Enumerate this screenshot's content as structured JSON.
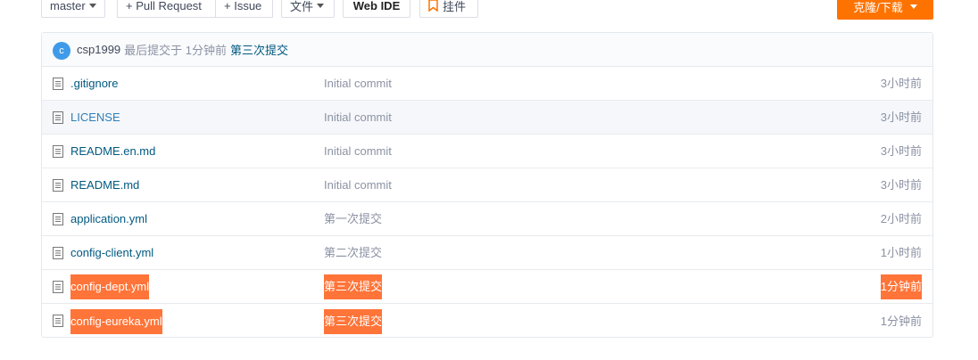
{
  "toolbar": {
    "branch": "master",
    "pull_request": "+ Pull Request",
    "issue": "+ Issue",
    "file_menu": "文件",
    "web_ide": "Web IDE",
    "plugin": "挂件",
    "clone": "克隆/下载"
  },
  "last_commit": {
    "avatar_letter": "c",
    "author": "csp1999",
    "meta_text": "最后提交于 1分钟前",
    "message": "第三次提交"
  },
  "files": [
    {
      "name": ".gitignore",
      "message": "Initial commit",
      "time": "3小时前"
    },
    {
      "name": "LICENSE",
      "message": "Initial commit",
      "time": "3小时前"
    },
    {
      "name": "README.en.md",
      "message": "Initial commit",
      "time": "3小时前"
    },
    {
      "name": "README.md",
      "message": "Initial commit",
      "time": "3小时前"
    },
    {
      "name": "application.yml",
      "message": "第一次提交",
      "time": "2小时前"
    },
    {
      "name": "config-client.yml",
      "message": "第二次提交",
      "time": "1小时前"
    },
    {
      "name": "config-dept.yml",
      "message": "第三次提交",
      "time": "1分钟前"
    },
    {
      "name": "config-eureka.yml",
      "message": "第三次提交",
      "time": "1分钟前"
    }
  ],
  "colors": {
    "accent": "#fe7300",
    "highlight": "#ff7438",
    "link": "#005980"
  }
}
